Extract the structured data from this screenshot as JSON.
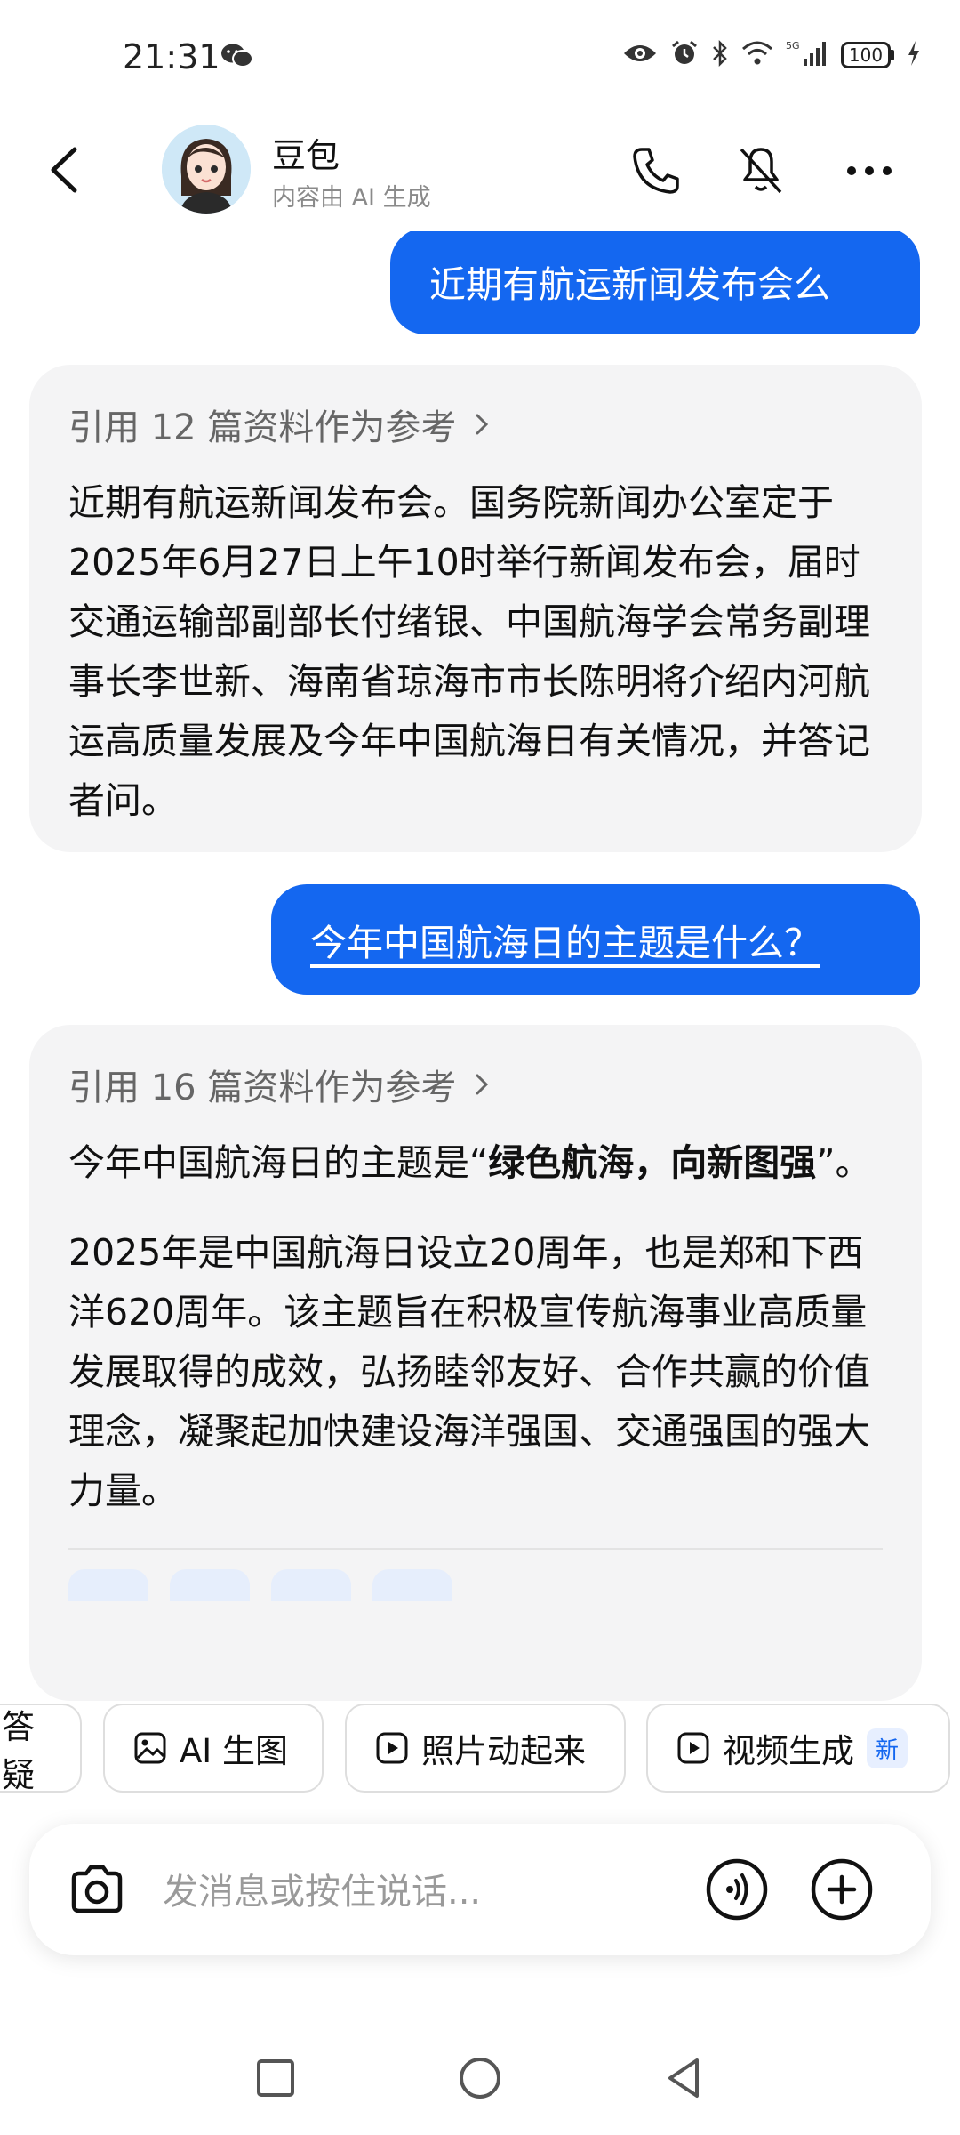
{
  "status_bar": {
    "time": "21:31",
    "battery": "100",
    "icons": [
      "wechat-icon",
      "eye-icon",
      "alarm-icon",
      "bluetooth-icon",
      "wifi-icon",
      "signal-icon",
      "battery-icon",
      "charging-icon"
    ],
    "network": "5G"
  },
  "header": {
    "name": "豆包",
    "subtitle": "内容由 AI 生成"
  },
  "messages": [
    {
      "role": "user",
      "text": "近期有航运新闻发布会么"
    },
    {
      "role": "assistant",
      "reference": "引用 12 篇资料作为参考",
      "text": "近期有航运新闻发布会。国务院新闻办公室定于2025年6月27日上午10时举行新闻发布会，届时交通运输部副部长付绪银、中国航海学会常务副理事长李世新、海南省琼海市市长陈明将介绍内河航运高质量发展及今年中国航海日有关情况，并答记者问。"
    },
    {
      "role": "user",
      "text": "今年中国航海日的主题是什么？"
    },
    {
      "role": "assistant",
      "reference": "引用 16 篇资料作为参考",
      "text_prefix": "今年中国航海日的主题是“",
      "text_bold": "绿色航海，向新图强",
      "text_suffix": "”。",
      "paragraph2": "2025年是中国航海日设立20周年，也是郑和下西洋620周年。该主题旨在积极宣传航海事业高质量发展取得的成效，弘扬睦邻友好、合作共赢的价值理念，凝聚起加快建设海洋强国、交通强国的强大力量。"
    }
  ],
  "shortcuts": [
    {
      "label": "答疑"
    },
    {
      "label": "AI 生图",
      "icon": "image-icon"
    },
    {
      "label": "照片动起来",
      "icon": "play-icon"
    },
    {
      "label": "视频生成",
      "icon": "play-icon",
      "badge": "新"
    }
  ],
  "input": {
    "placeholder": "发消息或按住说话..."
  },
  "colors": {
    "accent": "#1467f0",
    "ai_bubble": "#f4f4f5"
  }
}
